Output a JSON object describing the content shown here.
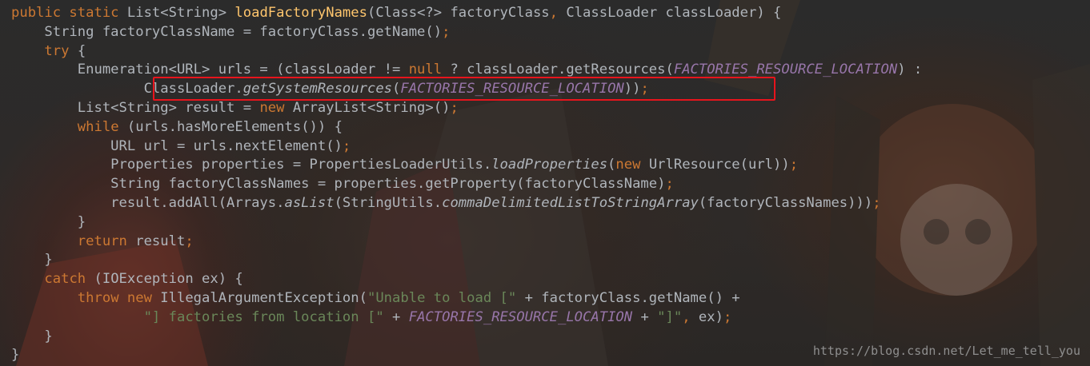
{
  "code_lines": [
    [
      {
        "c": "kw",
        "t": "public static "
      },
      {
        "c": "pl",
        "t": "List<String> "
      },
      {
        "c": "fn",
        "t": "loadFactoryNames"
      },
      {
        "c": "pl",
        "t": "(Class<?> factoryClass"
      },
      {
        "c": "kw",
        "t": ", "
      },
      {
        "c": "pl",
        "t": "ClassLoader classLoader) {"
      }
    ],
    [
      {
        "c": "pl",
        "t": "    String factoryClassName = factoryClass.getName()"
      },
      {
        "c": "semi",
        "t": ";"
      }
    ],
    [
      {
        "c": "pl",
        "t": "    "
      },
      {
        "c": "kw",
        "t": "try "
      },
      {
        "c": "pl",
        "t": "{"
      }
    ],
    [
      {
        "c": "pl",
        "t": "        Enumeration<URL> urls = (classLoader != "
      },
      {
        "c": "kw",
        "t": "null "
      },
      {
        "c": "pl",
        "t": "? classLoader.getResources("
      },
      {
        "c": "st",
        "t": "FACTORIES_RESOURCE_LOCATION"
      },
      {
        "c": "pl",
        "t": ") :"
      }
    ],
    [
      {
        "c": "pl",
        "t": "                ClassLoader."
      },
      {
        "c": "mi",
        "t": "getSystemResources"
      },
      {
        "c": "pl",
        "t": "("
      },
      {
        "c": "st",
        "t": "FACTORIES_RESOURCE_LOCATION"
      },
      {
        "c": "pl",
        "t": "))"
      },
      {
        "c": "semi",
        "t": ";"
      }
    ],
    [
      {
        "c": "pl",
        "t": "        List<String> result = "
      },
      {
        "c": "kw",
        "t": "new "
      },
      {
        "c": "pl",
        "t": "ArrayList<String>()"
      },
      {
        "c": "semi",
        "t": ";"
      }
    ],
    [
      {
        "c": "pl",
        "t": "        "
      },
      {
        "c": "kw",
        "t": "while "
      },
      {
        "c": "pl",
        "t": "(urls.hasMoreElements()) {"
      }
    ],
    [
      {
        "c": "pl",
        "t": "            URL url = urls.nextElement()"
      },
      {
        "c": "semi",
        "t": ";"
      }
    ],
    [
      {
        "c": "pl",
        "t": "            Properties properties = PropertiesLoaderUtils."
      },
      {
        "c": "mi",
        "t": "loadProperties"
      },
      {
        "c": "pl",
        "t": "("
      },
      {
        "c": "kw",
        "t": "new "
      },
      {
        "c": "pl",
        "t": "UrlResource(url))"
      },
      {
        "c": "semi",
        "t": ";"
      }
    ],
    [
      {
        "c": "pl",
        "t": "            String factoryClassNames = properties.getProperty(factoryClassName)"
      },
      {
        "c": "semi",
        "t": ";"
      }
    ],
    [
      {
        "c": "pl",
        "t": "            result.addAll(Arrays."
      },
      {
        "c": "mi",
        "t": "asList"
      },
      {
        "c": "pl",
        "t": "(StringUtils."
      },
      {
        "c": "mi",
        "t": "commaDelimitedListToStringArray"
      },
      {
        "c": "pl",
        "t": "(factoryClassNames)))"
      },
      {
        "c": "semi",
        "t": ";"
      }
    ],
    [
      {
        "c": "pl",
        "t": "        }"
      }
    ],
    [
      {
        "c": "pl",
        "t": "        "
      },
      {
        "c": "kw",
        "t": "return "
      },
      {
        "c": "pl",
        "t": "result"
      },
      {
        "c": "semi",
        "t": ";"
      }
    ],
    [
      {
        "c": "pl",
        "t": "    }"
      }
    ],
    [
      {
        "c": "pl",
        "t": "    "
      },
      {
        "c": "kw",
        "t": "catch "
      },
      {
        "c": "pl",
        "t": "(IOException ex) {"
      }
    ],
    [
      {
        "c": "pl",
        "t": "        "
      },
      {
        "c": "kw",
        "t": "throw new "
      },
      {
        "c": "pl",
        "t": "IllegalArgumentException("
      },
      {
        "c": "str",
        "t": "\"Unable to load [\" "
      },
      {
        "c": "pl",
        "t": "+ factoryClass.getName() +"
      }
    ],
    [
      {
        "c": "pl",
        "t": "                "
      },
      {
        "c": "str",
        "t": "\"] factories from location [\" "
      },
      {
        "c": "pl",
        "t": "+ "
      },
      {
        "c": "st",
        "t": "FACTORIES_RESOURCE_LOCATION "
      },
      {
        "c": "pl",
        "t": "+ "
      },
      {
        "c": "str",
        "t": "\"]\""
      },
      {
        "c": "kw",
        "t": ", "
      },
      {
        "c": "pl",
        "t": "ex)"
      },
      {
        "c": "semi",
        "t": ";"
      }
    ],
    [
      {
        "c": "pl",
        "t": "    }"
      }
    ],
    [
      {
        "c": "pl",
        "t": "}"
      }
    ]
  ],
  "highlighted_line": 4,
  "watermark": "https://blog.csdn.net/Let_me_tell_you",
  "colors": {
    "background": "#2b2b2b",
    "keyword": "#cc7832",
    "method_declaration": "#ffc66d",
    "static_constant": "#9876aa",
    "string": "#6a8759",
    "plain": "#b0b5bb",
    "highlight_border": "#e8141c"
  }
}
